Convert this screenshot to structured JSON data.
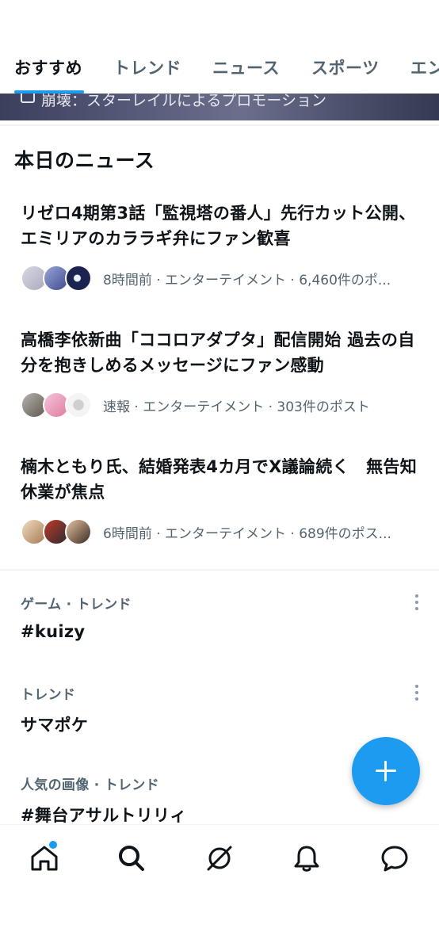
{
  "tabs": [
    {
      "label": "おすすめ",
      "active": true
    },
    {
      "label": "トレンド",
      "active": false
    },
    {
      "label": "ニュース",
      "active": false
    },
    {
      "label": "スポーツ",
      "active": false
    },
    {
      "label": "エン",
      "active": false
    }
  ],
  "promo": {
    "text": "崩壊：スターレイルによるプロモーション"
  },
  "today_news": {
    "title": "本日のニュース",
    "items": [
      {
        "headline": "リゼロ4期第3話「監視塔の番人」先行カット公開、エミリアのカララギ弁にファン歓喜",
        "meta": "8時間前 · エンターテイメント · 6,460件のポ..."
      },
      {
        "headline": "高橋李依新曲「ココロアダプタ」配信開始 過去の自分を抱きしめるメッセージにファン感動",
        "meta": "速報 · エンターテイメント · 303件のポスト"
      },
      {
        "headline": "楠木ともり氏、結婚発表4カ月でX議論続く　無告知休業が焦点",
        "meta": "6時間前 · エンターテイメント · 689件のポス..."
      }
    ]
  },
  "trends": [
    {
      "context": "ゲーム · トレンド",
      "name": "#kuizy"
    },
    {
      "context": "トレンド",
      "name": "サマポケ"
    },
    {
      "context": "人気の画像 · トレンド",
      "name": "#舞台アサルトリリィ"
    }
  ],
  "colors": {
    "accent": "#1d9bf0",
    "text_primary": "#0f1419",
    "text_secondary": "#536471"
  },
  "icons": {
    "fab": "plus-icon",
    "nav": [
      "home-icon",
      "search-icon",
      "grok-icon",
      "bell-icon",
      "message-icon"
    ]
  }
}
